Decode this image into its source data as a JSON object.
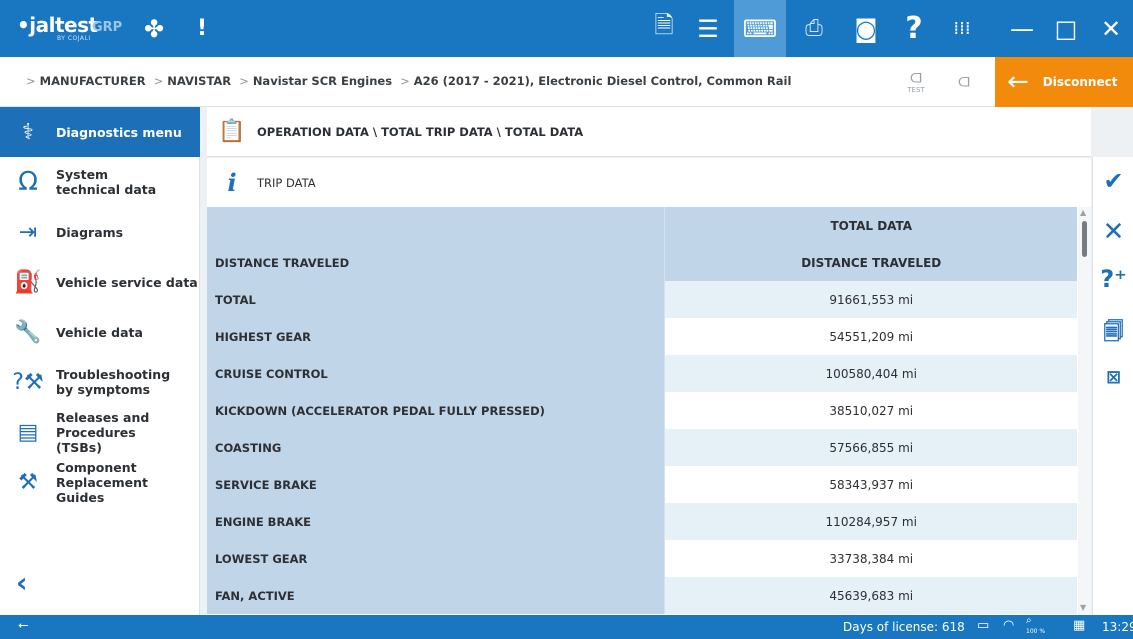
{
  "app": {
    "brand": "jaltest",
    "brand_sub": "BY COJALI",
    "grp": "GRP"
  },
  "toolbar": {
    "icons": [
      "report-icon",
      "list-icon",
      "keyboard-icon",
      "printer-icon",
      "camera-icon",
      "help-icon",
      "apps-icon"
    ],
    "window": [
      "minimize-icon",
      "maximize-icon",
      "close-icon"
    ]
  },
  "breadcrumb": {
    "items": [
      "MANUFACTURER",
      "NAVISTAR",
      "Navistar SCR Engines",
      "A26 (2017 - 2021), Electronic Diesel Control, Common Rail"
    ],
    "test_label": "TEST",
    "disconnect_label": "Disconnect"
  },
  "sidebar": {
    "items": [
      {
        "label": "Diagnostics menu",
        "icon": "stethoscope-icon",
        "active": true
      },
      {
        "label": "System technical data",
        "icon": "omega-icon"
      },
      {
        "label": "Diagrams",
        "icon": "diagram-icon"
      },
      {
        "label": "Vehicle service data",
        "icon": "oil-can-icon"
      },
      {
        "label": "Vehicle data",
        "icon": "wrench-icon"
      },
      {
        "label": "Troubleshooting by symptoms",
        "icon": "troubleshoot-icon"
      },
      {
        "label": "Releases and Procedures (TSBs)",
        "icon": "tsb-icon"
      },
      {
        "label": "Component Replacement Guides",
        "icon": "tools-icon"
      }
    ]
  },
  "section": {
    "title": "OPERATION DATA \\ TOTAL TRIP DATA \\ TOTAL DATA",
    "sub_title": "TRIP DATA"
  },
  "table": {
    "column_header": "TOTAL DATA",
    "rows": [
      {
        "label": "DISTANCE TRAVELED",
        "value": "DISTANCE TRAVELED",
        "header": true
      },
      {
        "label": "TOTAL",
        "value": "91661,553 mi"
      },
      {
        "label": "HIGHEST GEAR",
        "value": "54551,209 mi"
      },
      {
        "label": "CRUISE CONTROL",
        "value": "100580,404 mi"
      },
      {
        "label": "KICKDOWN (ACCELERATOR PEDAL FULLY PRESSED)",
        "value": "38510,027 mi"
      },
      {
        "label": "COASTING",
        "value": "57566,855 mi"
      },
      {
        "label": "SERVICE BRAKE",
        "value": "58343,937 mi"
      },
      {
        "label": "ENGINE BRAKE",
        "value": "110284,957 mi"
      },
      {
        "label": "LOWEST GEAR",
        "value": "33738,384 mi"
      },
      {
        "label": "FAN,  ACTIVE",
        "value": "45639,683 mi"
      }
    ]
  },
  "rightbar": {
    "icons": [
      "check-icon",
      "cancel-icon",
      "help-plus-icon",
      "report-add-icon",
      "excel-export-icon"
    ]
  },
  "status": {
    "license": "Days of license: 618",
    "zoom": "100 %",
    "time": "13:29"
  }
}
